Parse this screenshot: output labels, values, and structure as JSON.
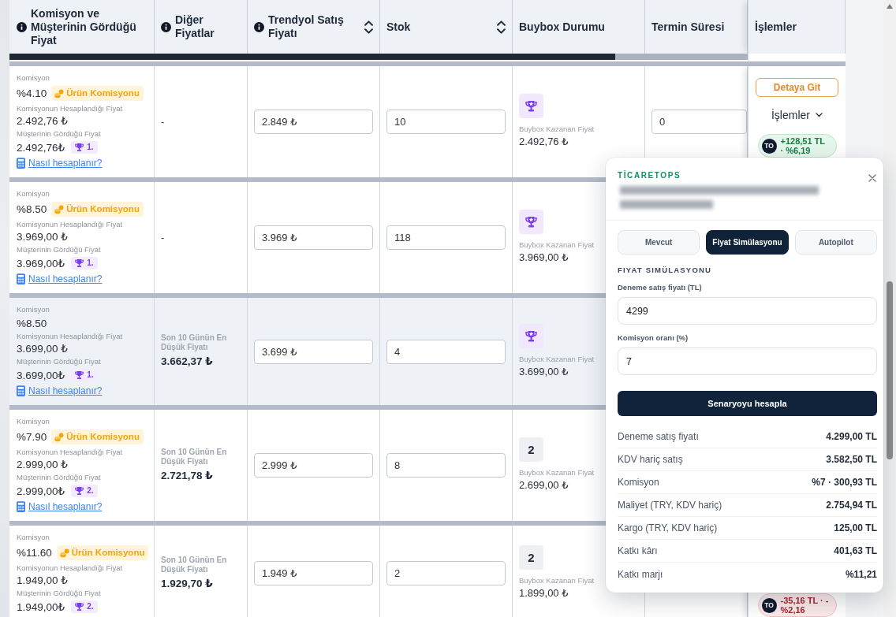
{
  "table": {
    "columns": [
      {
        "label": "Komisyon ve Müşterinin Gördüğü Fiyat",
        "info": true,
        "sortable": false
      },
      {
        "label": "Diğer Fiyatlar",
        "info": true,
        "sortable": false
      },
      {
        "label": "Trendyol Satış Fiyatı",
        "info": true,
        "sortable": true
      },
      {
        "label": "Stok",
        "info": false,
        "sortable": true
      },
      {
        "label": "Buybox Durumu",
        "info": false,
        "sortable": false
      },
      {
        "label": "Termin Süresi",
        "info": false,
        "sortable": false
      },
      {
        "label": "İşlemler",
        "info": false,
        "sortable": false
      }
    ],
    "rows": [
      {
        "highlighted": false,
        "commission": {
          "label": "Komisyon",
          "rate": "%4.10",
          "badge": "Ürün Komisyonu",
          "base_label": "Komisyonun Hesaplandığı Fiyat",
          "base_price": "2.492,76 ₺",
          "customer_label": "Müşterinin Gördüğü Fiyat",
          "customer_price": "2.492,76₺",
          "rank": "1.",
          "link": "Nasıl hesaplanır?"
        },
        "other_prices": {
          "kind": "empty",
          "text": "-"
        },
        "sale_price": "2.849 ₺",
        "stock": "10",
        "buybox": {
          "kind": "trophy",
          "label": "Buybox Kazanan Fiyat",
          "price": "2.492,76 ₺"
        },
        "lead_time": "0",
        "actions": {
          "detail_button": "Detaya Git",
          "menu": "İşlemler",
          "badge": {
            "avatar": "TO",
            "text": "+128,51 TL · %6,19",
            "negative": false
          }
        }
      },
      {
        "highlighted": false,
        "commission": {
          "label": "Komisyon",
          "rate": "%8.50",
          "badge": "Ürün Komisyonu",
          "base_label": "Komisyonun Hesaplandığı Fiyat",
          "base_price": "3.969,00 ₺",
          "customer_label": "Müşterinin Gördüğü Fiyat",
          "customer_price": "3.969,00₺",
          "rank": "1.",
          "link": "Nasıl hesaplanır?"
        },
        "other_prices": {
          "kind": "empty",
          "text": "-"
        },
        "sale_price": "3.969 ₺",
        "stock": "118",
        "buybox": {
          "kind": "trophy",
          "label": "Buybox Kazanan Fiyat",
          "price": "3.969,00 ₺"
        }
      },
      {
        "highlighted": true,
        "commission": {
          "label": "Komisyon",
          "rate": "%8.50",
          "base_label": "Komisyonun Hesaplandığı Fiyat",
          "base_price": "3.699,00 ₺",
          "customer_label": "Müşterinin Gördüğü Fiyat",
          "customer_price": "3.699,00₺",
          "rank": "1.",
          "link": "Nasıl hesaplanır?"
        },
        "other_prices": {
          "kind": "lowest",
          "label": "Son 10 Günün En Düşük Fiyatı",
          "value": "3.662,37 ₺"
        },
        "sale_price": "3.699 ₺",
        "stock": "4",
        "buybox": {
          "kind": "trophy",
          "label": "Buybox Kazanan Fiyat",
          "price": "3.699,00 ₺"
        }
      },
      {
        "highlighted": false,
        "commission": {
          "label": "Komisyon",
          "rate": "%7.90",
          "badge": "Ürün Komisyonu",
          "base_label": "Komisyonun Hesaplandığı Fiyat",
          "base_price": "2.999,00 ₺",
          "customer_label": "Müşterinin Gördüğü Fiyat",
          "customer_price": "2.999,00₺",
          "rank": "2.",
          "link": "Nasıl hesaplanır?"
        },
        "other_prices": {
          "kind": "lowest",
          "label": "Son 10 Günün En Düşük Fiyatı",
          "value": "2.721,78 ₺"
        },
        "sale_price": "2.999 ₺",
        "stock": "8",
        "buybox": {
          "kind": "rank",
          "rank": "2",
          "label": "Buybox Kazanan Fiyat",
          "price": "2.699,00 ₺"
        }
      },
      {
        "highlighted": false,
        "commission": {
          "label": "Komisyon",
          "rate": "%11.60",
          "badge": "Ürün Komisyonu",
          "base_label": "Komisyonun Hesaplandığı Fiyat",
          "base_price": "1.949,00 ₺",
          "customer_label": "Müşterinin Gördüğü Fiyat",
          "customer_price": "1.949,00₺",
          "rank": "2."
        },
        "other_prices": {
          "kind": "lowest",
          "label": "Son 10 Günün En Düşük Fiyatı",
          "value": "1.929,70 ₺"
        },
        "sale_price": "1.949 ₺",
        "stock": "2",
        "buybox": {
          "kind": "rank",
          "rank": "2",
          "label": "Buybox Kazanan Fiyat",
          "price": "1.899,00 ₺"
        },
        "actions": {
          "badge": {
            "avatar": "TO",
            "text": "-35,16 TL · -%2,16",
            "negative": true
          }
        }
      }
    ]
  },
  "popup": {
    "brand": "TİCARETOPS",
    "tabs": [
      {
        "label": "Mevcut",
        "selected": false
      },
      {
        "label": "Fiyat Simülasyonu",
        "selected": true
      },
      {
        "label": "Autopilot",
        "selected": false
      }
    ],
    "section_title": "FIYAT SIMÜLASYONU",
    "fields": [
      {
        "label": "Deneme satış fiyatı (TL)",
        "value": "4299"
      },
      {
        "label": "Komisyon oranı (%)",
        "value": "7"
      }
    ],
    "button": "Senaryoyu hesapla",
    "results": [
      {
        "label": "Deneme satış fiyatı",
        "value": "4.299,00 TL"
      },
      {
        "label": "KDV hariç satış",
        "value": "3.582,50 TL"
      },
      {
        "label": "Komisyon",
        "value": "%7 · 300,93 TL"
      },
      {
        "label": "Maliyet (TRY, KDV hariç)",
        "value": "2.754,94 TL"
      },
      {
        "label": "Kargo (TRY, KDV hariç)",
        "value": "125,00 TL"
      },
      {
        "label": "Katkı kârı",
        "value": "401,63 TL"
      },
      {
        "label": "Katkı marjı",
        "value": "%11,21"
      }
    ]
  }
}
